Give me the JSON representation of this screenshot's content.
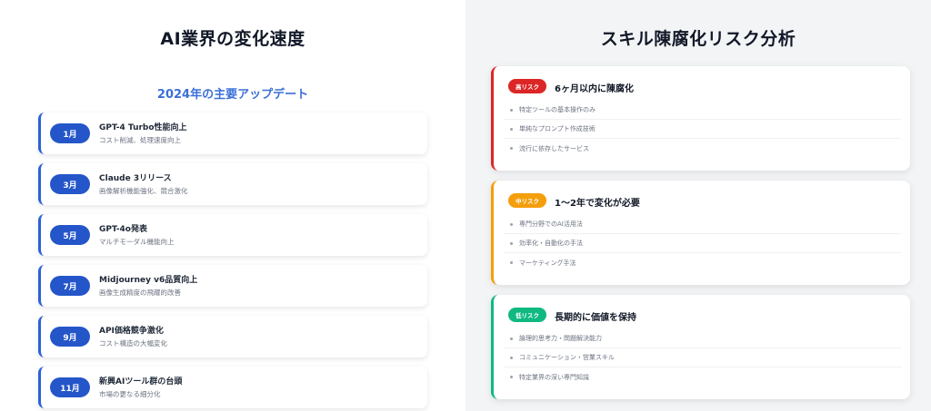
{
  "left": {
    "title": "AI業界の変化速度",
    "subtitle": "2024年の主要アップデート",
    "items": [
      {
        "month": "1月",
        "title": "GPT-4 Turbo性能向上",
        "desc": "コスト削減、処理速度向上"
      },
      {
        "month": "3月",
        "title": "Claude 3リリース",
        "desc": "画像解析機能強化、競合激化"
      },
      {
        "month": "5月",
        "title": "GPT-4o発表",
        "desc": "マルチモーダル機能向上"
      },
      {
        "month": "7月",
        "title": "Midjourney v6品質向上",
        "desc": "画像生成精度の飛躍的改善"
      },
      {
        "month": "9月",
        "title": "API価格競争激化",
        "desc": "コスト構造の大幅変化"
      },
      {
        "month": "11月",
        "title": "新興AIツール群の台頭",
        "desc": "市場の更なる細分化"
      }
    ]
  },
  "right": {
    "title": "スキル陳腐化リスク分析",
    "cards": [
      {
        "badge": "高リスク",
        "title": "6ヶ月以内に陳腐化",
        "items": [
          "特定ツールの基本操作のみ",
          "単純なプロンプト作成技術",
          "流行に依存したサービス"
        ]
      },
      {
        "badge": "中リスク",
        "title": "1〜2年で変化が必要",
        "items": [
          "専門分野でのAI活用法",
          "効率化・自動化の手法",
          "マーケティング手法"
        ]
      },
      {
        "badge": "低リスク",
        "title": "長期的に価値を保持",
        "items": [
          "論理的思考力・問題解決能力",
          "コミュニケーション・営業スキル",
          "特定業界の深い専門知識"
        ]
      }
    ]
  },
  "colors": {
    "accent": "#2456c9",
    "high": "#dc2626",
    "medium": "#f59e0b",
    "low": "#10b981"
  }
}
